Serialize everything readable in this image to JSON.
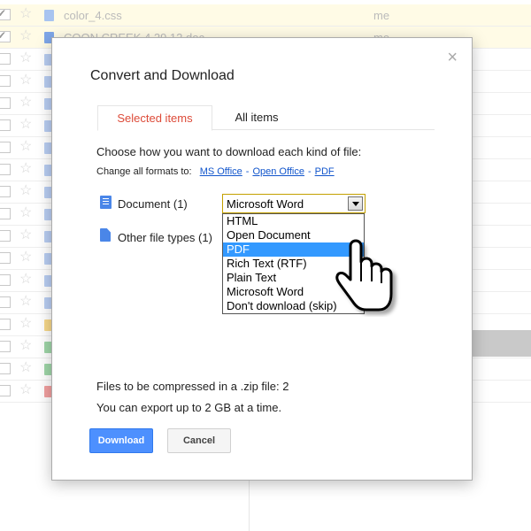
{
  "background": {
    "rows": [
      {
        "name": "color_4.css",
        "owner": "me",
        "checked": true,
        "highlight": true,
        "icon_color": "#a8c4f0"
      },
      {
        "name": "COON CREEK 4.29.12.doc",
        "owner": "me",
        "checked": true,
        "highlight": true,
        "icon_color": "#7ea6e8"
      },
      {
        "name": "",
        "owner": "",
        "checked": false,
        "highlight": false,
        "icon_color": "#b9cdf2"
      },
      {
        "name": "",
        "owner": "",
        "checked": false,
        "highlight": false,
        "icon_color": "#b9cdf2"
      },
      {
        "name": "",
        "owner": "",
        "checked": false,
        "highlight": false,
        "icon_color": "#b9cdf2"
      },
      {
        "name": "",
        "owner": "",
        "checked": false,
        "highlight": false,
        "icon_color": "#b9cdf2"
      },
      {
        "name": "",
        "owner": "",
        "checked": false,
        "highlight": false,
        "icon_color": "#b9cdf2"
      },
      {
        "name": "",
        "owner": "",
        "checked": false,
        "highlight": false,
        "icon_color": "#b9cdf2"
      },
      {
        "name": "",
        "owner": "",
        "checked": false,
        "highlight": false,
        "icon_color": "#b9cdf2"
      },
      {
        "name": "",
        "owner": "",
        "checked": false,
        "highlight": false,
        "icon_color": "#b9cdf2"
      },
      {
        "name": "",
        "owner": "",
        "checked": false,
        "highlight": false,
        "icon_color": "#b9cdf2"
      },
      {
        "name": "",
        "owner": "",
        "checked": false,
        "highlight": false,
        "icon_color": "#b9cdf2"
      },
      {
        "name": "",
        "owner": "",
        "checked": false,
        "highlight": false,
        "icon_color": "#b9cdf2"
      },
      {
        "name": "",
        "owner": "",
        "checked": false,
        "highlight": false,
        "icon_color": "#b9cdf2"
      },
      {
        "name": "",
        "owner": "",
        "checked": false,
        "highlight": false,
        "icon_color": "#f7d88a"
      },
      {
        "name": "",
        "owner": "",
        "checked": false,
        "highlight": false,
        "icon_color": "#9fd6a8"
      },
      {
        "name": "",
        "owner": "",
        "checked": false,
        "highlight": false,
        "icon_color": "#9fd6a8"
      },
      {
        "name": "",
        "owner": "",
        "checked": false,
        "highlight": false,
        "icon_color": "#f2a0a0"
      }
    ]
  },
  "dialog": {
    "title": "Convert and Download",
    "close_glyph": "×",
    "tabs": [
      {
        "label": "Selected items",
        "active": true
      },
      {
        "label": "All items",
        "active": false
      }
    ],
    "choose_text": "Choose how you want to download each kind of file:",
    "change_all": {
      "prefix": "Change all formats to:",
      "links": [
        "MS Office",
        "Open Office",
        "PDF"
      ],
      "separator": "-"
    },
    "document_label": "Document (1)",
    "other_label": "Other file types (1)",
    "format_select": {
      "selected": "Microsoft Word",
      "options": [
        "HTML",
        "Open Document",
        "PDF",
        "Rich Text (RTF)",
        "Plain Text",
        "Microsoft Word",
        "Don't download (skip)"
      ],
      "highlighted_index": 2
    },
    "compress_text": "Files to be compressed in a .zip file: 2",
    "export_text": "You can export up to 2 GB at a time.",
    "download_label": "Download",
    "cancel_label": "Cancel"
  },
  "colors": {
    "accent_blue": "#4d90fe",
    "active_tab_red": "#dd4b39",
    "link_blue": "#1155cc",
    "option_highlight": "#3399ff"
  }
}
